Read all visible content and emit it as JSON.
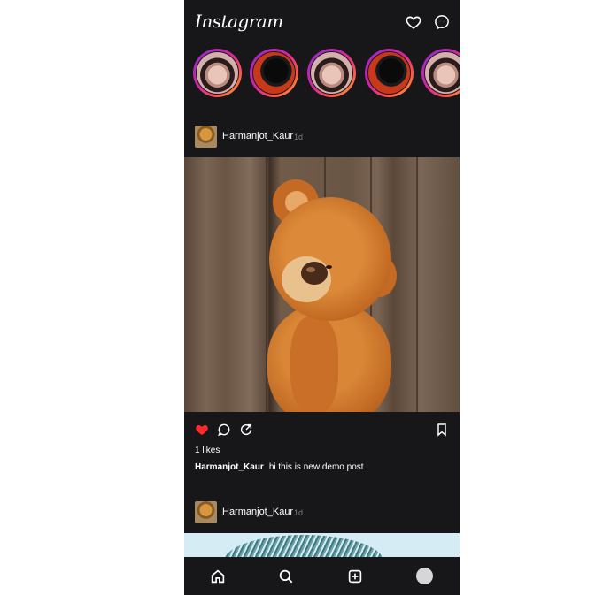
{
  "app": {
    "logo_text": "Instagram"
  },
  "colors": {
    "background": "#171719",
    "like_red": "#ff2a2a",
    "time_gray": "#7d7d7d"
  },
  "header": {
    "icons": [
      "heart-icon",
      "messenger-icon"
    ]
  },
  "stories": [
    {
      "icon": "story-avatar-portrait"
    },
    {
      "icon": "story-avatar-silhouette"
    },
    {
      "icon": "story-avatar-portrait"
    },
    {
      "icon": "story-avatar-silhouette"
    },
    {
      "icon": "story-avatar-portrait"
    }
  ],
  "posts": [
    {
      "username": "Harmanjot_Kaur",
      "time": "1d",
      "image": "teddy-bear-photo",
      "liked": true,
      "likes_text": "1 likes",
      "caption_user": "Harmanjot_Kaur",
      "caption_text": "hi this is new demo post"
    },
    {
      "username": "Harmanjot_Kaur",
      "time": "1d",
      "image": "scribble-drawing"
    }
  ],
  "bottom_nav": [
    "home-icon",
    "search-icon",
    "add-post-icon",
    "profile-avatar"
  ]
}
